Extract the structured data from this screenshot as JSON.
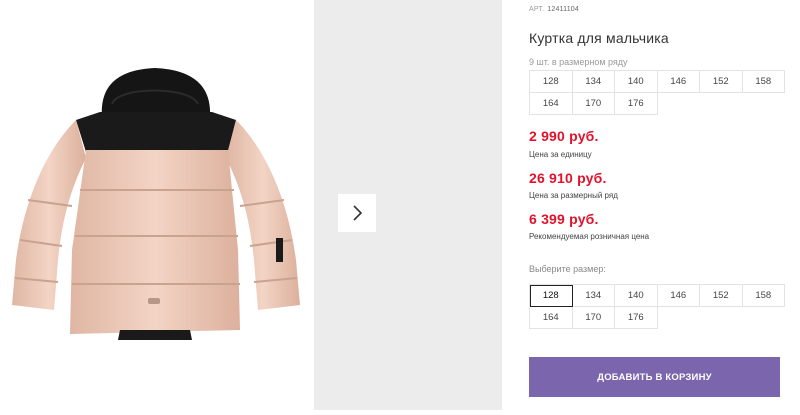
{
  "product": {
    "sku_label": "АРТ.",
    "sku_value": "12411104",
    "title": "Куртка для мальчика",
    "row_count": "9 шт. в размерном ряду"
  },
  "size_row": [
    "128",
    "134",
    "140",
    "146",
    "152",
    "158",
    "164",
    "170",
    "176"
  ],
  "prices": [
    {
      "value": "2 990 руб.",
      "label": "Цена за единицу"
    },
    {
      "value": "26 910 руб.",
      "label": "Цена за размерный ряд"
    },
    {
      "value": "6 399 руб.",
      "label": "Рекомендуемая розничная цена"
    }
  ],
  "size_select": {
    "label": "Выберите размер:",
    "options": [
      "128",
      "134",
      "140",
      "146",
      "152",
      "158",
      "164",
      "170",
      "176"
    ],
    "selected": "128"
  },
  "cart_button": "ДОБАВИТЬ В КОРЗИНУ",
  "colors": {
    "price_red": "#e2122b",
    "button_purple": "#7b65ad",
    "jacket_beige": "#ecc8b7",
    "jacket_black": "#141414"
  },
  "icons": {
    "next": "chevron-right-icon"
  }
}
